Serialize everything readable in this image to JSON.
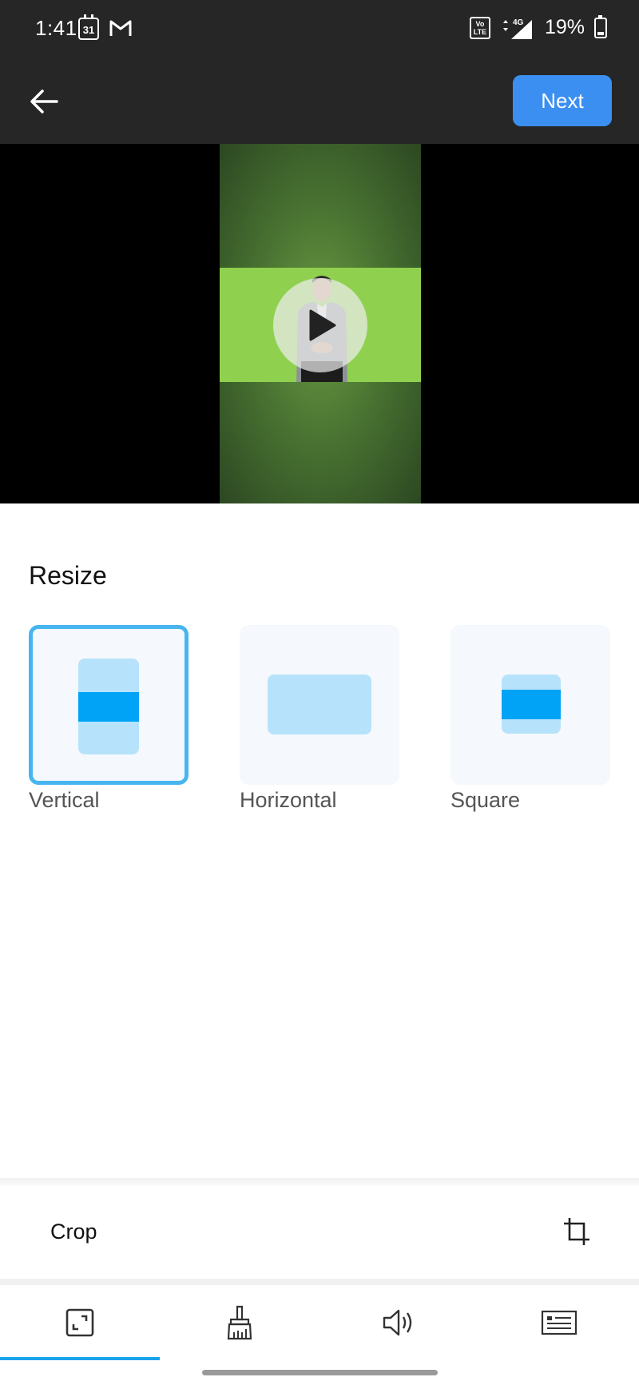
{
  "status_bar": {
    "time": "1:41",
    "calendar_day": "31",
    "gmail_icon": "gmail-icon",
    "volte_text": "Vo LTE",
    "network": "4G",
    "battery_percent": "19%"
  },
  "app_bar": {
    "back_icon": "arrow-left-icon",
    "next_label": "Next",
    "next_color": "#3b8ff0"
  },
  "preview": {
    "play_icon": "play-icon"
  },
  "resize": {
    "title": "Resize",
    "options": [
      {
        "label": "Vertical",
        "selected": true
      },
      {
        "label": "Horizontal",
        "selected": false
      },
      {
        "label": "Square",
        "selected": false
      }
    ],
    "accent_color": "#47b5ef"
  },
  "crop": {
    "label": "Crop",
    "icon": "crop-icon"
  },
  "tabs": [
    {
      "icon": "resize-icon",
      "active": true
    },
    {
      "icon": "brush-icon",
      "active": false
    },
    {
      "icon": "speaker-icon",
      "active": false
    },
    {
      "icon": "caption-icon",
      "active": false
    }
  ]
}
